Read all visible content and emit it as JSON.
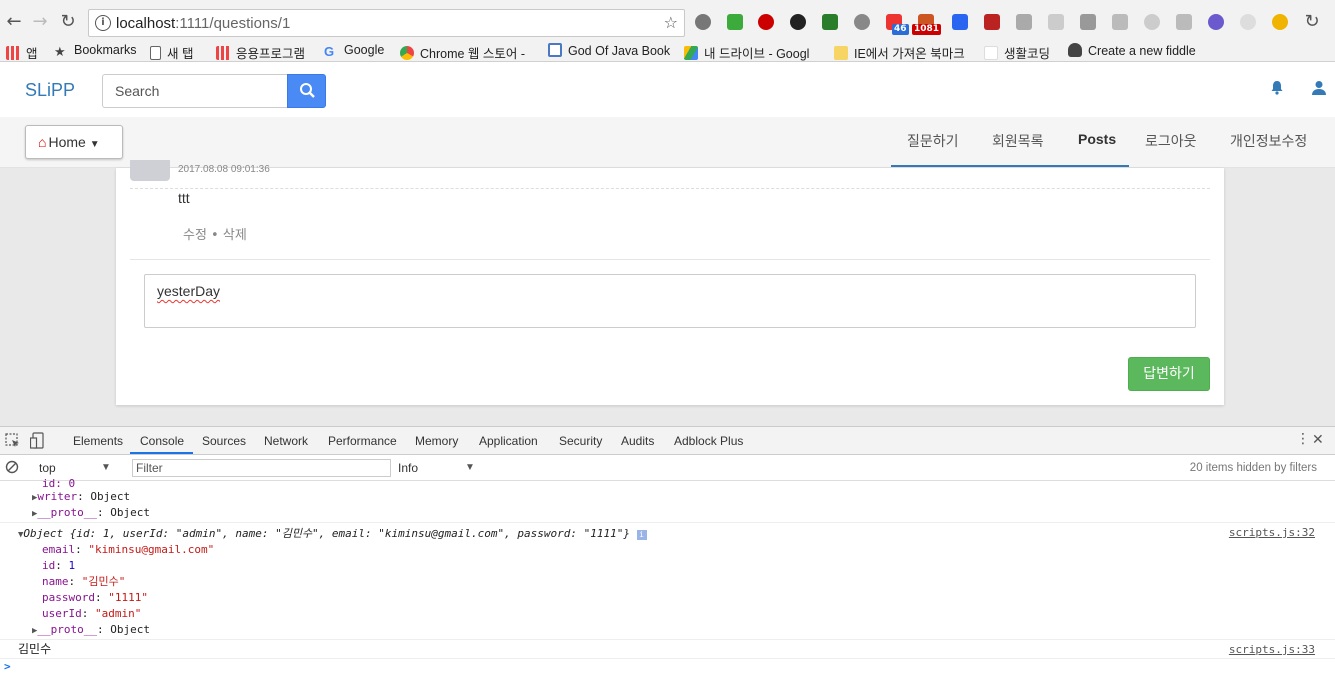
{
  "browser": {
    "url_host": "localhost",
    "url_path": ":1111/questions/1",
    "bookmarks": [
      "앱",
      "Bookmarks",
      "새 탭",
      "응용프로그램",
      "Google",
      "Chrome 웹 스토어 -",
      "God Of Java Book",
      "내 드라이브 - Googl",
      "IE에서 가져온 북마크",
      "생활코딩",
      "Create a new fiddle"
    ],
    "ext_badges": [
      "46",
      "1081"
    ]
  },
  "navbar": {
    "brand": "SLiPP",
    "search_placeholder": "Search",
    "home_label": "Home",
    "menu": [
      "질문하기",
      "회원목록",
      "Posts",
      "로그아웃",
      "개인정보수정"
    ],
    "active_menu": "Posts"
  },
  "answer": {
    "date": "2017.08.08 09:01:36",
    "body": "ttt",
    "actions": "수정 • 삭제"
  },
  "reply": {
    "text": "yesterDay",
    "button": "답변하기"
  },
  "devtools": {
    "tabs": [
      "Elements",
      "Console",
      "Sources",
      "Network",
      "Performance",
      "Memory",
      "Application",
      "Security",
      "Audits",
      "Adblock Plus"
    ],
    "active_tab": "Console",
    "context": "top",
    "filter_placeholder": "Filter",
    "level": "Info",
    "hidden_count": "20 items hidden by filters",
    "console": {
      "cut_line": "id: 0",
      "writer_key": "writer",
      "writer_val": "Object",
      "proto_key": "__proto__",
      "proto_val": "Object",
      "summary": "Object {id: 1, userId: \"admin\", name: \"김민수\", email: \"kiminsu@gmail.com\", password: \"1111\"}",
      "source1": "scripts.js:32",
      "fields": [
        {
          "key": "email",
          "value": "\"kiminsu@gmail.com\""
        },
        {
          "key": "id",
          "value": "1"
        },
        {
          "key": "name",
          "value": "\"김민수\""
        },
        {
          "key": "password",
          "value": "\"1111\""
        },
        {
          "key": "userId",
          "value": "\"admin\""
        }
      ],
      "proto2_key": "__proto__",
      "proto2_val": "Object",
      "log_name": "김민수",
      "source2": "scripts.js:33",
      "prompt": ">"
    }
  }
}
